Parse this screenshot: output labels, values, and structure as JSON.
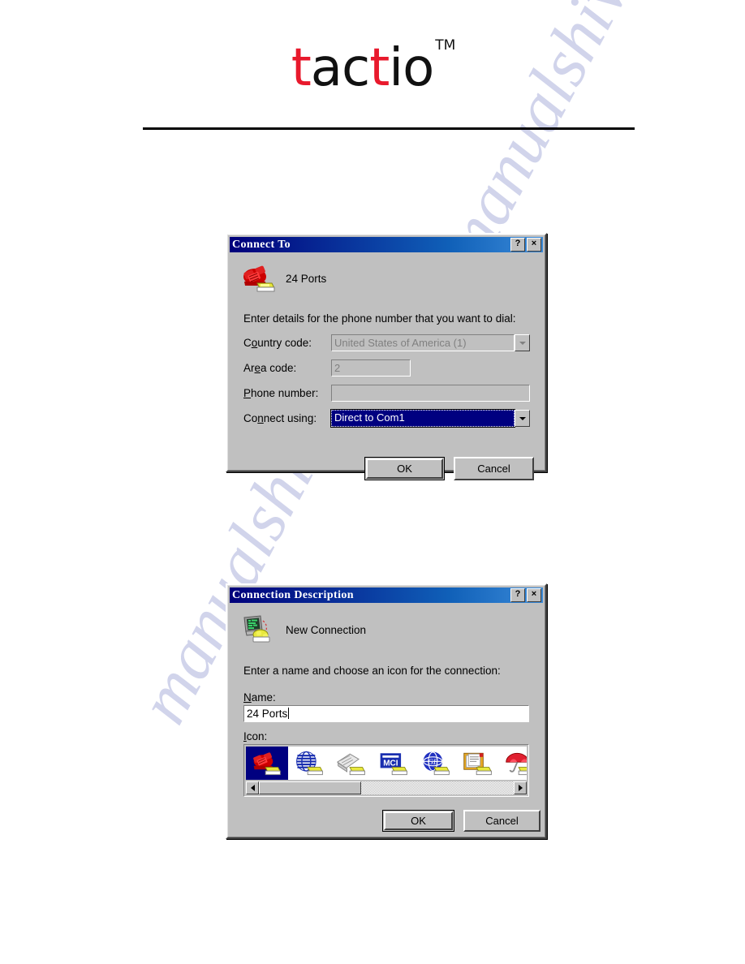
{
  "page": {
    "background_color": "#ffffff",
    "watermark_text_right": "manualshive.Com",
    "watermark_text_left": "manualshive.Com",
    "watermark_color": "#c9cde8"
  },
  "header": {
    "logo_part1": "t",
    "logo_part2": "ac",
    "logo_part3": "t",
    "logo_part4": "io",
    "logo_tm": "TM",
    "logo_red": "#e8192c",
    "logo_black": "#111111"
  },
  "dialog_connect_to": {
    "title": "Connect To",
    "help_button": "?",
    "close_button": "×",
    "connection_name": "24 Ports",
    "connection_icon": "red-telephone-modem-icon",
    "instruction": "Enter details for the phone number that you want to dial:",
    "fields": [
      {
        "label_prefix": "C",
        "label_underlined": "o",
        "label_suffix": "untry code:",
        "label_full": "Country code:",
        "value": "United States of America (1)",
        "type": "combobox",
        "disabled": true
      },
      {
        "label_prefix": "Ar",
        "label_underlined": "e",
        "label_suffix": "a code:",
        "label_full": "Area code:",
        "value": "2",
        "type": "textbox",
        "disabled": true
      },
      {
        "label_prefix": "",
        "label_underlined": "P",
        "label_suffix": "hone number:",
        "label_full": "Phone number:",
        "value": "",
        "type": "textbox",
        "disabled": false
      },
      {
        "label_prefix": "Co",
        "label_underlined": "n",
        "label_suffix": "nect using:",
        "label_full": "Connect using:",
        "value": "Direct to Com1",
        "type": "combobox",
        "disabled": false,
        "selected": true
      }
    ],
    "ok_label": "OK",
    "cancel_label": "Cancel",
    "selection_color": "#000080",
    "titlebar_color_start": "#00007b",
    "titlebar_color_end": "#3a8ad8"
  },
  "dialog_connection_description": {
    "title": "Connection Description",
    "help_button": "?",
    "close_button": "×",
    "connection_name": "New Connection",
    "connection_icon": "computer-modem-icon",
    "instruction": "Enter a name and choose an icon for the connection:",
    "name_label_underlined": "N",
    "name_label_rest": "ame:",
    "name_label_full": "Name:",
    "name_value": "24 Ports",
    "icon_label_underlined": "I",
    "icon_label_rest": "con:",
    "icon_label_full": "Icon:",
    "icons": [
      {
        "name": "red-telephone-modem-icon",
        "selected": true
      },
      {
        "name": "blue-globe-modem-icon",
        "selected": false
      },
      {
        "name": "fax-machine-modem-icon",
        "selected": false
      },
      {
        "name": "mci-logo-modem-icon",
        "selected": false
      },
      {
        "name": "ge-globe-modem-icon",
        "selected": false
      },
      {
        "name": "documents-modem-icon",
        "selected": false
      },
      {
        "name": "red-umbrella-modem-icon",
        "selected": false
      }
    ],
    "scrollbar": {
      "left_arrow": "◄",
      "right_arrow": "►",
      "thumb_position_percent": 0,
      "thumb_width_percent": 40
    },
    "ok_label": "OK",
    "cancel_label": "Cancel"
  }
}
